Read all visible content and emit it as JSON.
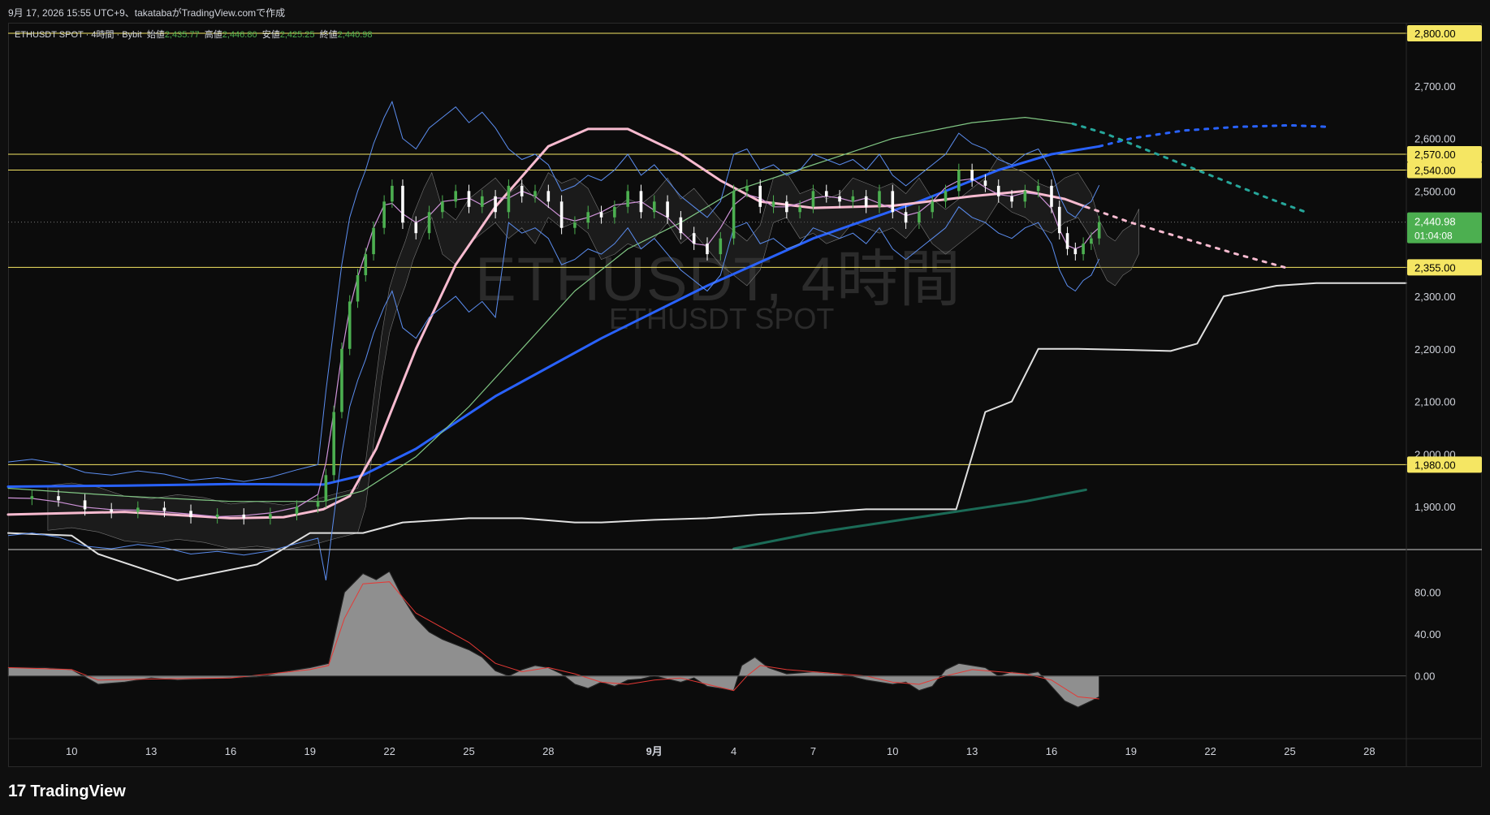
{
  "header": {
    "caption": "9月 17, 2026 15:55 UTC+9、takatabaがTradingView.comで作成"
  },
  "legend": {
    "symbol": "ETHUSDT SPOT · 4時間 · Bybit",
    "open_label": "始値",
    "open": "2,435.77",
    "high_label": "高値",
    "high": "2,446.80",
    "low_label": "安値",
    "low": "2,425.25",
    "close_label": "終値",
    "close": "2,440.98"
  },
  "watermark": {
    "main": "ETHUSDT, 4時間",
    "sub": "ETHUSDT SPOT"
  },
  "footer": {
    "brand": "TradingView",
    "logo_icon": "tradingview-logo-icon"
  },
  "colors": {
    "background": "#0c0c0c",
    "up": "#4caf50",
    "down": "#ffffff",
    "level_line": "#f5e663",
    "level_label_bg": "#f5e663",
    "price_label_bg": "#4caf50",
    "ma_blue": "#2962ff",
    "ma_pink": "#f8bbd0",
    "ma_green": "#81c784",
    "band_blue": "#5b8def",
    "purple": "#ce93d8",
    "white_line": "#e0e0e0",
    "teal": "#1b6b57",
    "cloud": "#3a3a3a"
  },
  "chart_data": [
    {
      "type": "candlestick",
      "title": "ETHUSDT, 4時間",
      "xlabel": "",
      "ylabel": "",
      "ylim": [
        1820,
        2820
      ],
      "y_ticks": [
        1900,
        2000,
        2100,
        2200,
        2300,
        2400,
        2500,
        2600,
        2700,
        2800
      ],
      "y_tick_labels": [
        "1,900.00",
        "2,000.00",
        "2,100.00",
        "2,200.00",
        "2,300.00",
        "",
        "2,500.00",
        "2,600.00",
        "2,700.00",
        ""
      ],
      "x_tick_labels": [
        "10",
        "13",
        "16",
        "19",
        "22",
        "25",
        "28",
        "9月",
        "4",
        "7",
        "10",
        "13",
        "16",
        "19",
        "22",
        "25",
        "28"
      ],
      "x_tick_days": [
        10,
        13,
        16,
        19,
        22,
        25,
        28,
        32,
        35,
        38,
        41,
        44,
        47,
        50,
        53,
        56,
        59
      ],
      "x_range_days": [
        7.6,
        60.4
      ],
      "current_price": {
        "value": 2440.98,
        "label": "2,440.98",
        "countdown": "01:04:08"
      },
      "levels": [
        {
          "value": 2800,
          "label": "2,800.00"
        },
        {
          "value": 2570,
          "label": "2,570.00"
        },
        {
          "value": 2540,
          "label": "2,540.00"
        },
        {
          "value": 2355,
          "label": "2,355.00"
        },
        {
          "value": 1980,
          "label": "1,980.00"
        }
      ],
      "series": [
        {
          "kind": "close",
          "x": [
            7.6,
            8.5,
            9.5,
            10.5,
            11.5,
            12.5,
            13.5,
            14.5,
            15.5,
            16.5,
            17.5,
            18.5,
            19.3,
            19.6,
            19.9,
            20.2,
            20.5,
            20.8,
            21.1,
            21.4,
            21.8,
            22.1,
            22.5,
            23,
            23.5,
            24,
            24.5,
            25,
            25.5,
            26,
            26.5,
            27,
            27.5,
            28,
            28.5,
            29,
            29.5,
            30,
            30.5,
            31,
            31.5,
            32,
            32.5,
            33,
            33.5,
            34,
            34.5,
            35,
            35.5,
            36,
            36.5,
            37,
            37.5,
            38,
            38.5,
            39,
            39.5,
            40,
            40.5,
            41,
            41.5,
            42,
            42.5,
            43,
            43.5,
            44,
            44.5,
            45,
            45.5,
            46,
            46.5,
            47,
            47.3,
            47.6,
            47.9,
            48.2,
            48.5,
            48.8
          ],
          "values": [
            1915,
            1920,
            1912,
            1895,
            1890,
            1898,
            1892,
            1880,
            1885,
            1878,
            1886,
            1900,
            1910,
            1960,
            2080,
            2200,
            2290,
            2340,
            2380,
            2430,
            2480,
            2510,
            2440,
            2420,
            2460,
            2480,
            2500,
            2470,
            2490,
            2460,
            2510,
            2490,
            2500,
            2480,
            2430,
            2440,
            2460,
            2450,
            2470,
            2500,
            2460,
            2480,
            2450,
            2420,
            2400,
            2380,
            2410,
            2500,
            2510,
            2470,
            2480,
            2460,
            2470,
            2500,
            2490,
            2480,
            2490,
            2470,
            2500,
            2460,
            2440,
            2460,
            2480,
            2500,
            2540,
            2520,
            2510,
            2490,
            2480,
            2500,
            2510,
            2470,
            2420,
            2390,
            2380,
            2400,
            2410,
            2441
          ]
        },
        {
          "kind": "ma_blue",
          "x": [
            7.6,
            12,
            16,
            19.5,
            21,
            23,
            26,
            30,
            34,
            38,
            42,
            45,
            47,
            48.8
          ],
          "values": [
            1938,
            1940,
            1943,
            1942,
            1960,
            2010,
            2110,
            2220,
            2320,
            2410,
            2480,
            2540,
            2570,
            2585
          ]
        },
        {
          "kind": "ma_blue_proj",
          "x": [
            48.8,
            50,
            52,
            54,
            56,
            57.5
          ],
          "values": [
            2585,
            2600,
            2615,
            2622,
            2625,
            2622
          ]
        },
        {
          "kind": "ma_pink",
          "x": [
            7.6,
            12,
            16,
            18,
            19.5,
            20.5,
            21.5,
            23,
            24.5,
            26,
            28,
            29.5,
            31,
            33,
            34.5,
            36,
            38,
            41,
            44,
            46,
            47.5,
            48.3
          ],
          "values": [
            1885,
            1890,
            1878,
            1880,
            1895,
            1920,
            2010,
            2200,
            2360,
            2470,
            2585,
            2618,
            2618,
            2570,
            2520,
            2480,
            2468,
            2472,
            2490,
            2500,
            2485,
            2470
          ]
        },
        {
          "kind": "ma_pink_proj",
          "x": [
            48.3,
            50,
            52,
            54,
            55.8
          ],
          "values": [
            2470,
            2440,
            2410,
            2380,
            2355
          ]
        },
        {
          "kind": "ma_green",
          "x": [
            7.6,
            12,
            16,
            19.5,
            21,
            23,
            25,
            27,
            29,
            31,
            33,
            35,
            38,
            41,
            44,
            46,
            47.8
          ],
          "values": [
            1935,
            1920,
            1910,
            1910,
            1930,
            1995,
            2090,
            2200,
            2310,
            2390,
            2440,
            2500,
            2550,
            2600,
            2630,
            2640,
            2628
          ]
        },
        {
          "kind": "ma_green_proj",
          "x": [
            47.8,
            49,
            50.5,
            52,
            53.5,
            55,
            56.6
          ],
          "values": [
            2628,
            2610,
            2580,
            2550,
            2520,
            2490,
            2460
          ]
        },
        {
          "kind": "white_line",
          "x": [
            7.6,
            10,
            11,
            14,
            17,
            19,
            21,
            22.5,
            25,
            27,
            29,
            30,
            32,
            34,
            36,
            38,
            40,
            42,
            43,
            43.4,
            44.5,
            45.5,
            46.5,
            48,
            50,
            51.5,
            52.5,
            53.5,
            55.5,
            57,
            59,
            60.4
          ],
          "values": [
            1850,
            1845,
            1810,
            1760,
            1790,
            1850,
            1850,
            1870,
            1878,
            1878,
            1870,
            1870,
            1875,
            1878,
            1885,
            1888,
            1895,
            1895,
            1895,
            1895,
            2080,
            2100,
            2200,
            2200,
            2198,
            2196,
            2210,
            2300,
            2320,
            2325,
            2325,
            2325
          ]
        },
        {
          "kind": "teal_line",
          "x": [
            35,
            38,
            42,
            46,
            48.3
          ],
          "values": [
            1820,
            1850,
            1880,
            1910,
            1932
          ]
        }
      ]
    },
    {
      "type": "area",
      "title": "",
      "ylim": [
        -60,
        120
      ],
      "y_ticks": [
        0,
        40,
        80
      ],
      "y_tick_labels": [
        "0.00",
        "40.00",
        "80.00"
      ],
      "series": [
        {
          "kind": "oscillator",
          "x": [
            7.6,
            9,
            10,
            11,
            12,
            13,
            14,
            15,
            16,
            17,
            18,
            19,
            19.7,
            20.3,
            21,
            21.5,
            22,
            22.5,
            23,
            23.5,
            24,
            25,
            25.5,
            26,
            26.5,
            27,
            27.5,
            28,
            28.5,
            29,
            29.5,
            30,
            30.5,
            31,
            31.5,
            32,
            33,
            33.5,
            34,
            34.5,
            35,
            35.3,
            35.8,
            36.3,
            37,
            38,
            39,
            40,
            41,
            41.5,
            42,
            42.5,
            43,
            43.5,
            44,
            44.5,
            45,
            45.5,
            46,
            46.5,
            47,
            47.5,
            48,
            48.5,
            48.8
          ],
          "values": [
            8,
            8,
            6,
            -8,
            -6,
            -2,
            -4,
            -3,
            -2,
            -1,
            4,
            8,
            12,
            80,
            98,
            92,
            100,
            75,
            55,
            42,
            35,
            25,
            18,
            5,
            0,
            6,
            10,
            8,
            2,
            -8,
            -12,
            -6,
            -10,
            -4,
            -3,
            0,
            -6,
            -2,
            -10,
            -12,
            -14,
            10,
            18,
            8,
            2,
            4,
            2,
            -4,
            -8,
            -6,
            -14,
            -10,
            6,
            12,
            10,
            8,
            0,
            4,
            2,
            4,
            -10,
            -24,
            -30,
            -24,
            -20
          ]
        },
        {
          "kind": "signal",
          "x": [
            7.6,
            10,
            11,
            13,
            16,
            19,
            19.7,
            20.3,
            21,
            22,
            23,
            25,
            26,
            27,
            28,
            29,
            30,
            31,
            32,
            33,
            34,
            35,
            35.5,
            36,
            37,
            38,
            40,
            41,
            42,
            43,
            44,
            45,
            46,
            47,
            48,
            48.8
          ],
          "values": [
            8,
            6,
            -4,
            -3,
            -2,
            6,
            10,
            55,
            88,
            90,
            60,
            32,
            12,
            4,
            8,
            2,
            -6,
            -8,
            -4,
            -2,
            -8,
            -14,
            0,
            10,
            6,
            4,
            0,
            -6,
            -8,
            0,
            6,
            4,
            2,
            -4,
            -20,
            -22
          ]
        }
      ]
    }
  ]
}
